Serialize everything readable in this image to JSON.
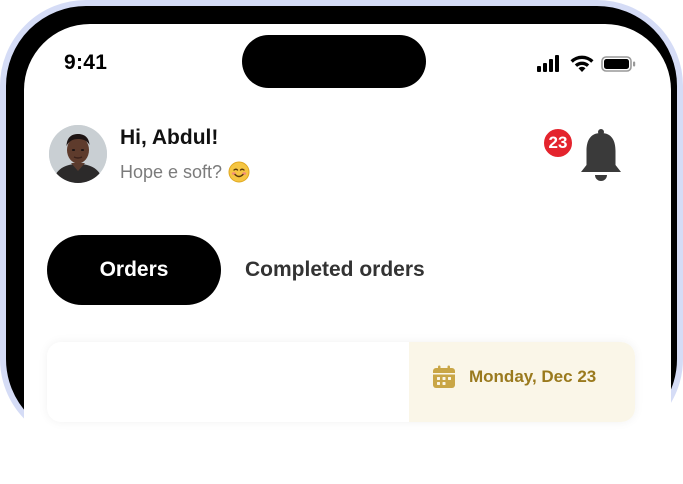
{
  "status_bar": {
    "time": "9:41"
  },
  "header": {
    "greeting": "Hi, Abdul!",
    "subtitle": "Hope e soft?",
    "notification_count": "23"
  },
  "tabs": [
    {
      "label": "Orders",
      "active": true
    },
    {
      "label": "Completed orders",
      "active": false
    }
  ],
  "order_card": {
    "date": "Monday, Dec 23"
  },
  "colors": {
    "frame": "#d5dcf6",
    "badge": "#e4242d",
    "date_chip_bg": "#faf6e8",
    "date_accent": "#9a7a1e",
    "active_tab": "#000000"
  },
  "icons": [
    "cellular-signal-icon",
    "wifi-icon",
    "battery-icon",
    "smiling-face-emoji-icon",
    "bell-icon",
    "calendar-icon"
  ]
}
